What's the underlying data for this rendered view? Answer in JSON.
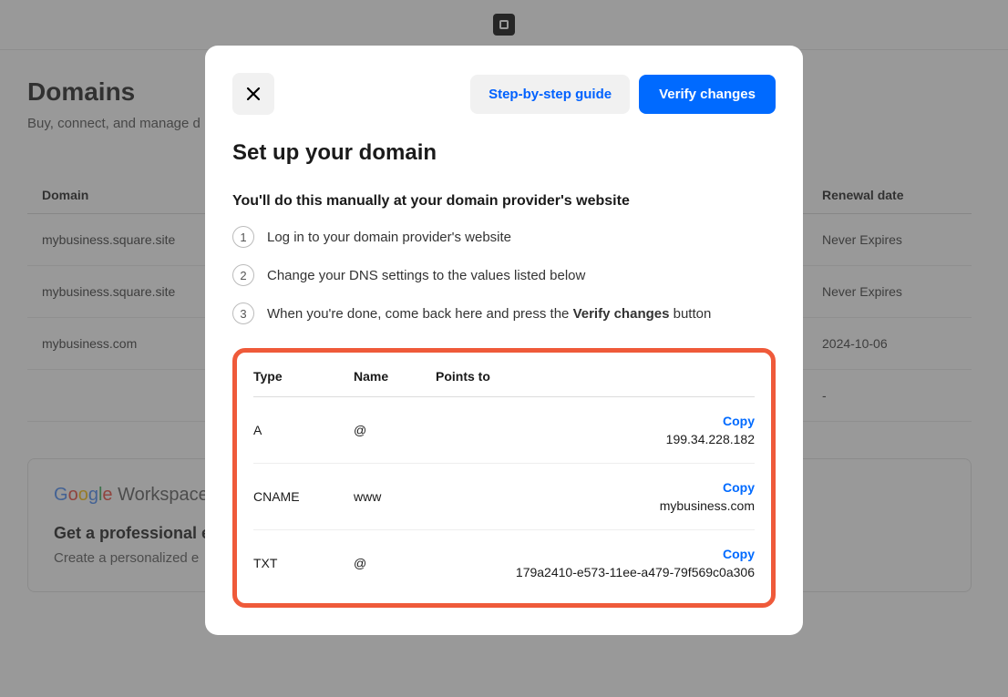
{
  "page": {
    "title": "Domains",
    "subtitle": "Buy, connect, and manage d"
  },
  "table": {
    "headers": {
      "domain": "Domain",
      "renewal": "Renewal date"
    },
    "rows": [
      {
        "domain": "mybusiness.square.site",
        "renewal": "Never Expires"
      },
      {
        "domain": "mybusiness.square.site",
        "renewal": "Never Expires"
      },
      {
        "domain": "mybusiness.com",
        "renewal": "2024-10-06"
      },
      {
        "domain": "",
        "renewal": "-"
      }
    ]
  },
  "workspace": {
    "brand_google": "Google",
    "brand_ws": " Workspace",
    "heading": "Get a professional e",
    "sub": "Create a personalized e"
  },
  "modal": {
    "guide_btn": "Step-by-step guide",
    "verify_btn": "Verify changes",
    "title": "Set up your domain",
    "instruction": "You'll do this manually at your domain provider's website",
    "steps": [
      "Log in to your domain provider's website",
      "Change your DNS settings to the values listed below",
      "When you're done, come back here and press the "
    ],
    "step3_bold": "Verify changes",
    "step3_tail": " button",
    "dns_headers": {
      "type": "Type",
      "name": "Name",
      "points": "Points to"
    },
    "copy_label": "Copy",
    "records": [
      {
        "type": "A",
        "name": "@",
        "value": "199.34.228.182"
      },
      {
        "type": "CNAME",
        "name": "www",
        "value": "mybusiness.com"
      },
      {
        "type": "TXT",
        "name": "@",
        "value": "179a2410-e573-11ee-a479-79f569c0a306"
      }
    ]
  }
}
